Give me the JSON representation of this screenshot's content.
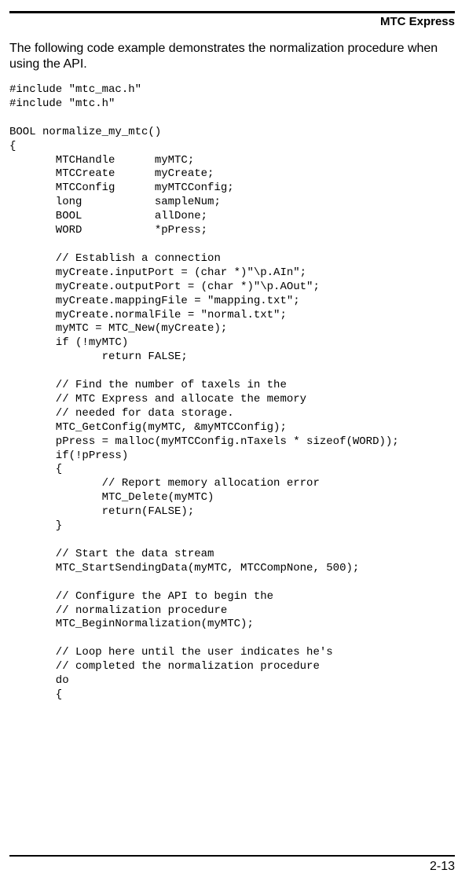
{
  "header": {
    "title": "MTC Express"
  },
  "intro": {
    "text": "The following code example demonstrates the normalization procedure when using the API."
  },
  "code": {
    "body": "#include \"mtc_mac.h\"\n#include \"mtc.h\"\n\nBOOL normalize_my_mtc()\n{\n       MTCHandle      myMTC;\n       MTCCreate      myCreate;\n       MTCConfig      myMTCConfig;\n       long           sampleNum;\n       BOOL           allDone;\n       WORD           *pPress;\n\n       // Establish a connection\n       myCreate.inputPort = (char *)\"\\p.AIn\";\n       myCreate.outputPort = (char *)\"\\p.AOut\";\n       myCreate.mappingFile = \"mapping.txt\";\n       myCreate.normalFile = \"normal.txt\";\n       myMTC = MTC_New(myCreate);\n       if (!myMTC)\n              return FALSE;\n\n       // Find the number of taxels in the\n       // MTC Express and allocate the memory\n       // needed for data storage.\n       MTC_GetConfig(myMTC, &myMTCConfig);\n       pPress = malloc(myMTCConfig.nTaxels * sizeof(WORD));\n       if(!pPress)\n       {\n              // Report memory allocation error\n              MTC_Delete(myMTC)\n              return(FALSE);\n       }\n\n       // Start the data stream\n       MTC_StartSendingData(myMTC, MTCCompNone, 500);\n\n       // Configure the API to begin the\n       // normalization procedure\n       MTC_BeginNormalization(myMTC);\n\n       // Loop here until the user indicates he's\n       // completed the normalization procedure\n       do\n       {"
  },
  "footer": {
    "pagenum": "2-13"
  }
}
